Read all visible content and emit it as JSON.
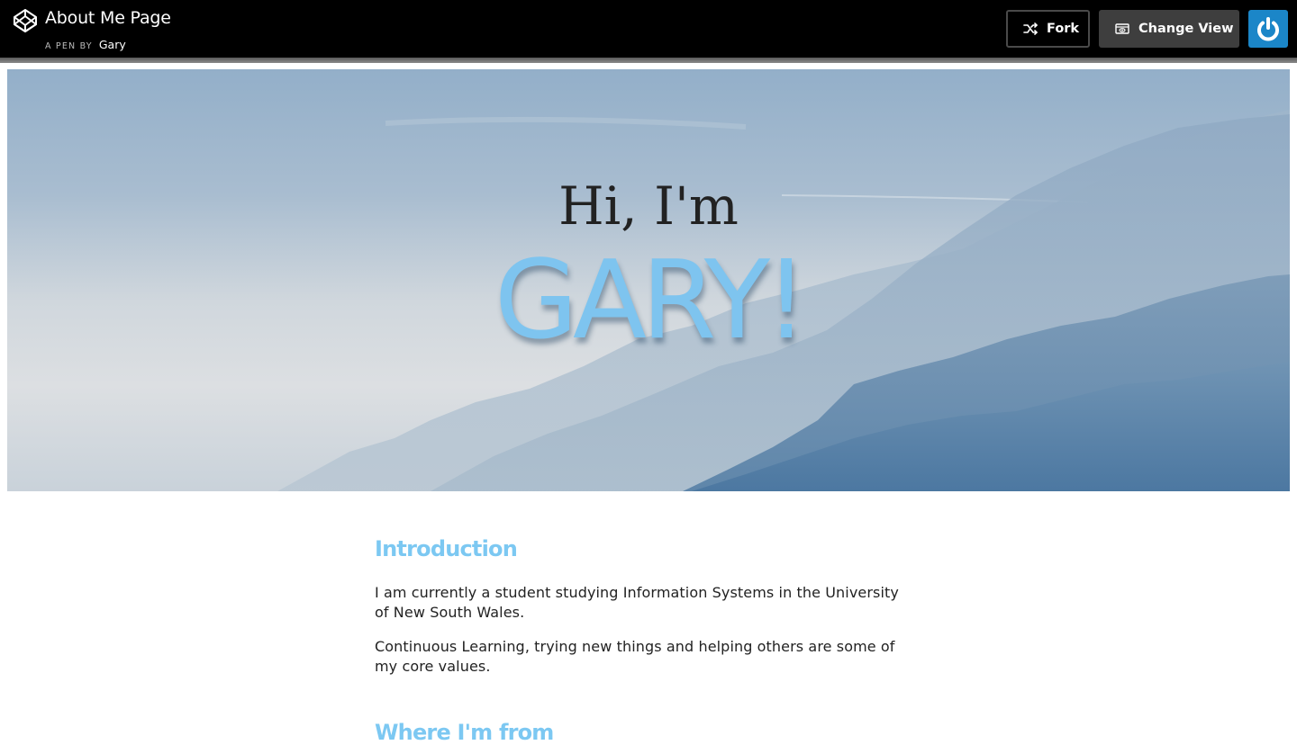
{
  "header": {
    "pen_title": "About Me Page",
    "by_label": "A PEN BY",
    "author": "Gary",
    "fork_label": "Fork",
    "change_view_label": "Change View",
    "icons": {
      "logo": "codepen-logo-icon",
      "fork": "fork-icon",
      "change_view": "eye-icon",
      "power": "power-icon"
    }
  },
  "hero": {
    "greeting": "Hi, I'm",
    "name": "GARY!"
  },
  "content": {
    "intro_heading": "Introduction",
    "intro_p1": "I am currently a student studying Information Systems in the University of New South Wales.",
    "intro_p2": "Continuous Learning, trying new things and helping others are some of my core values.",
    "from_heading": "Where I'm from"
  },
  "colors": {
    "accent": "#7cc8f2",
    "topbar": "#000000",
    "power_button": "#1b86c8"
  }
}
